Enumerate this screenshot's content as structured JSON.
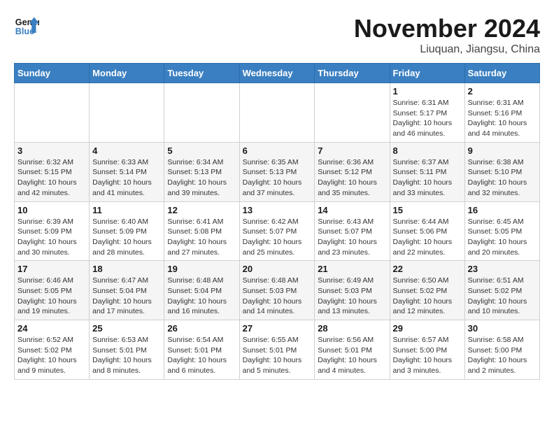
{
  "header": {
    "logo_general": "General",
    "logo_blue": "Blue",
    "month_title": "November 2024",
    "location": "Liuquan, Jiangsu, China"
  },
  "days_of_week": [
    "Sunday",
    "Monday",
    "Tuesday",
    "Wednesday",
    "Thursday",
    "Friday",
    "Saturday"
  ],
  "weeks": [
    [
      {
        "day": "",
        "info": ""
      },
      {
        "day": "",
        "info": ""
      },
      {
        "day": "",
        "info": ""
      },
      {
        "day": "",
        "info": ""
      },
      {
        "day": "",
        "info": ""
      },
      {
        "day": "1",
        "info": "Sunrise: 6:31 AM\nSunset: 5:17 PM\nDaylight: 10 hours and 46 minutes."
      },
      {
        "day": "2",
        "info": "Sunrise: 6:31 AM\nSunset: 5:16 PM\nDaylight: 10 hours and 44 minutes."
      }
    ],
    [
      {
        "day": "3",
        "info": "Sunrise: 6:32 AM\nSunset: 5:15 PM\nDaylight: 10 hours and 42 minutes."
      },
      {
        "day": "4",
        "info": "Sunrise: 6:33 AM\nSunset: 5:14 PM\nDaylight: 10 hours and 41 minutes."
      },
      {
        "day": "5",
        "info": "Sunrise: 6:34 AM\nSunset: 5:13 PM\nDaylight: 10 hours and 39 minutes."
      },
      {
        "day": "6",
        "info": "Sunrise: 6:35 AM\nSunset: 5:13 PM\nDaylight: 10 hours and 37 minutes."
      },
      {
        "day": "7",
        "info": "Sunrise: 6:36 AM\nSunset: 5:12 PM\nDaylight: 10 hours and 35 minutes."
      },
      {
        "day": "8",
        "info": "Sunrise: 6:37 AM\nSunset: 5:11 PM\nDaylight: 10 hours and 33 minutes."
      },
      {
        "day": "9",
        "info": "Sunrise: 6:38 AM\nSunset: 5:10 PM\nDaylight: 10 hours and 32 minutes."
      }
    ],
    [
      {
        "day": "10",
        "info": "Sunrise: 6:39 AM\nSunset: 5:09 PM\nDaylight: 10 hours and 30 minutes."
      },
      {
        "day": "11",
        "info": "Sunrise: 6:40 AM\nSunset: 5:09 PM\nDaylight: 10 hours and 28 minutes."
      },
      {
        "day": "12",
        "info": "Sunrise: 6:41 AM\nSunset: 5:08 PM\nDaylight: 10 hours and 27 minutes."
      },
      {
        "day": "13",
        "info": "Sunrise: 6:42 AM\nSunset: 5:07 PM\nDaylight: 10 hours and 25 minutes."
      },
      {
        "day": "14",
        "info": "Sunrise: 6:43 AM\nSunset: 5:07 PM\nDaylight: 10 hours and 23 minutes."
      },
      {
        "day": "15",
        "info": "Sunrise: 6:44 AM\nSunset: 5:06 PM\nDaylight: 10 hours and 22 minutes."
      },
      {
        "day": "16",
        "info": "Sunrise: 6:45 AM\nSunset: 5:05 PM\nDaylight: 10 hours and 20 minutes."
      }
    ],
    [
      {
        "day": "17",
        "info": "Sunrise: 6:46 AM\nSunset: 5:05 PM\nDaylight: 10 hours and 19 minutes."
      },
      {
        "day": "18",
        "info": "Sunrise: 6:47 AM\nSunset: 5:04 PM\nDaylight: 10 hours and 17 minutes."
      },
      {
        "day": "19",
        "info": "Sunrise: 6:48 AM\nSunset: 5:04 PM\nDaylight: 10 hours and 16 minutes."
      },
      {
        "day": "20",
        "info": "Sunrise: 6:48 AM\nSunset: 5:03 PM\nDaylight: 10 hours and 14 minutes."
      },
      {
        "day": "21",
        "info": "Sunrise: 6:49 AM\nSunset: 5:03 PM\nDaylight: 10 hours and 13 minutes."
      },
      {
        "day": "22",
        "info": "Sunrise: 6:50 AM\nSunset: 5:02 PM\nDaylight: 10 hours and 12 minutes."
      },
      {
        "day": "23",
        "info": "Sunrise: 6:51 AM\nSunset: 5:02 PM\nDaylight: 10 hours and 10 minutes."
      }
    ],
    [
      {
        "day": "24",
        "info": "Sunrise: 6:52 AM\nSunset: 5:02 PM\nDaylight: 10 hours and 9 minutes."
      },
      {
        "day": "25",
        "info": "Sunrise: 6:53 AM\nSunset: 5:01 PM\nDaylight: 10 hours and 8 minutes."
      },
      {
        "day": "26",
        "info": "Sunrise: 6:54 AM\nSunset: 5:01 PM\nDaylight: 10 hours and 6 minutes."
      },
      {
        "day": "27",
        "info": "Sunrise: 6:55 AM\nSunset: 5:01 PM\nDaylight: 10 hours and 5 minutes."
      },
      {
        "day": "28",
        "info": "Sunrise: 6:56 AM\nSunset: 5:01 PM\nDaylight: 10 hours and 4 minutes."
      },
      {
        "day": "29",
        "info": "Sunrise: 6:57 AM\nSunset: 5:00 PM\nDaylight: 10 hours and 3 minutes."
      },
      {
        "day": "30",
        "info": "Sunrise: 6:58 AM\nSunset: 5:00 PM\nDaylight: 10 hours and 2 minutes."
      }
    ]
  ]
}
